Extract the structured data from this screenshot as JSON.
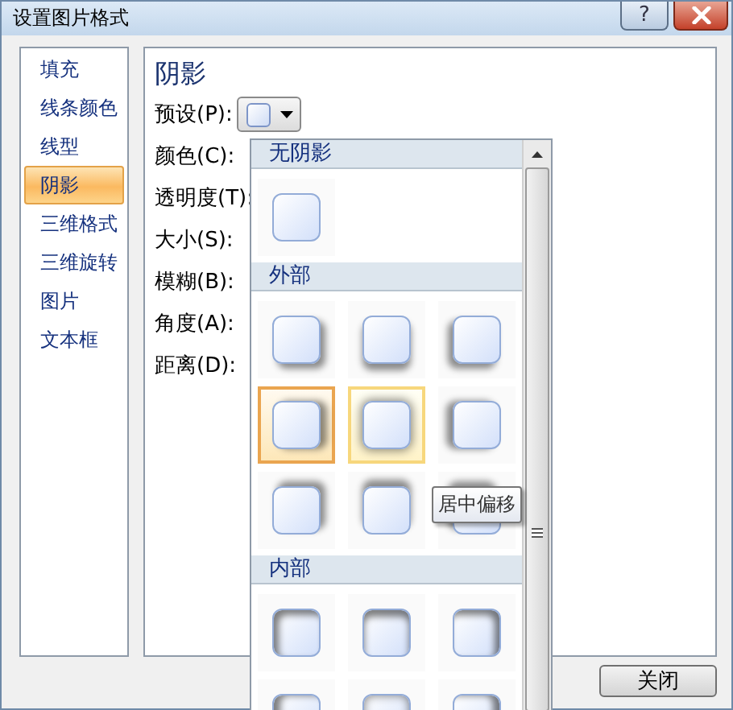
{
  "window": {
    "title": "设置图片格式",
    "help_button": "?"
  },
  "sidebar": {
    "items": [
      {
        "label": "填充",
        "selected": false
      },
      {
        "label": "线条颜色",
        "selected": false
      },
      {
        "label": "线型",
        "selected": false
      },
      {
        "label": "阴影",
        "selected": true
      },
      {
        "label": "三维格式",
        "selected": false
      },
      {
        "label": "三维旋转",
        "selected": false
      },
      {
        "label": "图片",
        "selected": false
      },
      {
        "label": "文本框",
        "selected": false
      }
    ]
  },
  "panel": {
    "heading": "阴影",
    "preset": {
      "label": "预设(P):"
    },
    "fields": [
      {
        "label": "颜色(C):"
      },
      {
        "label": "透明度(T):"
      },
      {
        "label": "大小(S):"
      },
      {
        "label": "模糊(B):"
      },
      {
        "label": "角度(A):"
      },
      {
        "label": "距离(D):"
      }
    ]
  },
  "preset_popup": {
    "groups": [
      {
        "title": "无阴影",
        "kind": "none",
        "cells": [
          {
            "selected": false,
            "hovered": false
          }
        ]
      },
      {
        "title": "外部",
        "kind": "outer",
        "cells": [
          {
            "selected": false,
            "hovered": false
          },
          {
            "selected": false,
            "hovered": false
          },
          {
            "selected": false,
            "hovered": false
          },
          {
            "selected": true,
            "hovered": false
          },
          {
            "selected": false,
            "hovered": true
          },
          {
            "selected": false,
            "hovered": false
          },
          {
            "selected": false,
            "hovered": false
          },
          {
            "selected": false,
            "hovered": false
          },
          {
            "selected": false,
            "hovered": false
          }
        ]
      },
      {
        "title": "内部",
        "kind": "inner",
        "cells": [
          {
            "selected": false,
            "hovered": false
          },
          {
            "selected": false,
            "hovered": false
          },
          {
            "selected": false,
            "hovered": false
          },
          {
            "selected": false,
            "hovered": false
          },
          {
            "selected": false,
            "hovered": false
          },
          {
            "selected": false,
            "hovered": false
          }
        ]
      }
    ]
  },
  "tooltip": "居中偏移",
  "buttons": [
    {
      "label": "关闭"
    }
  ]
}
